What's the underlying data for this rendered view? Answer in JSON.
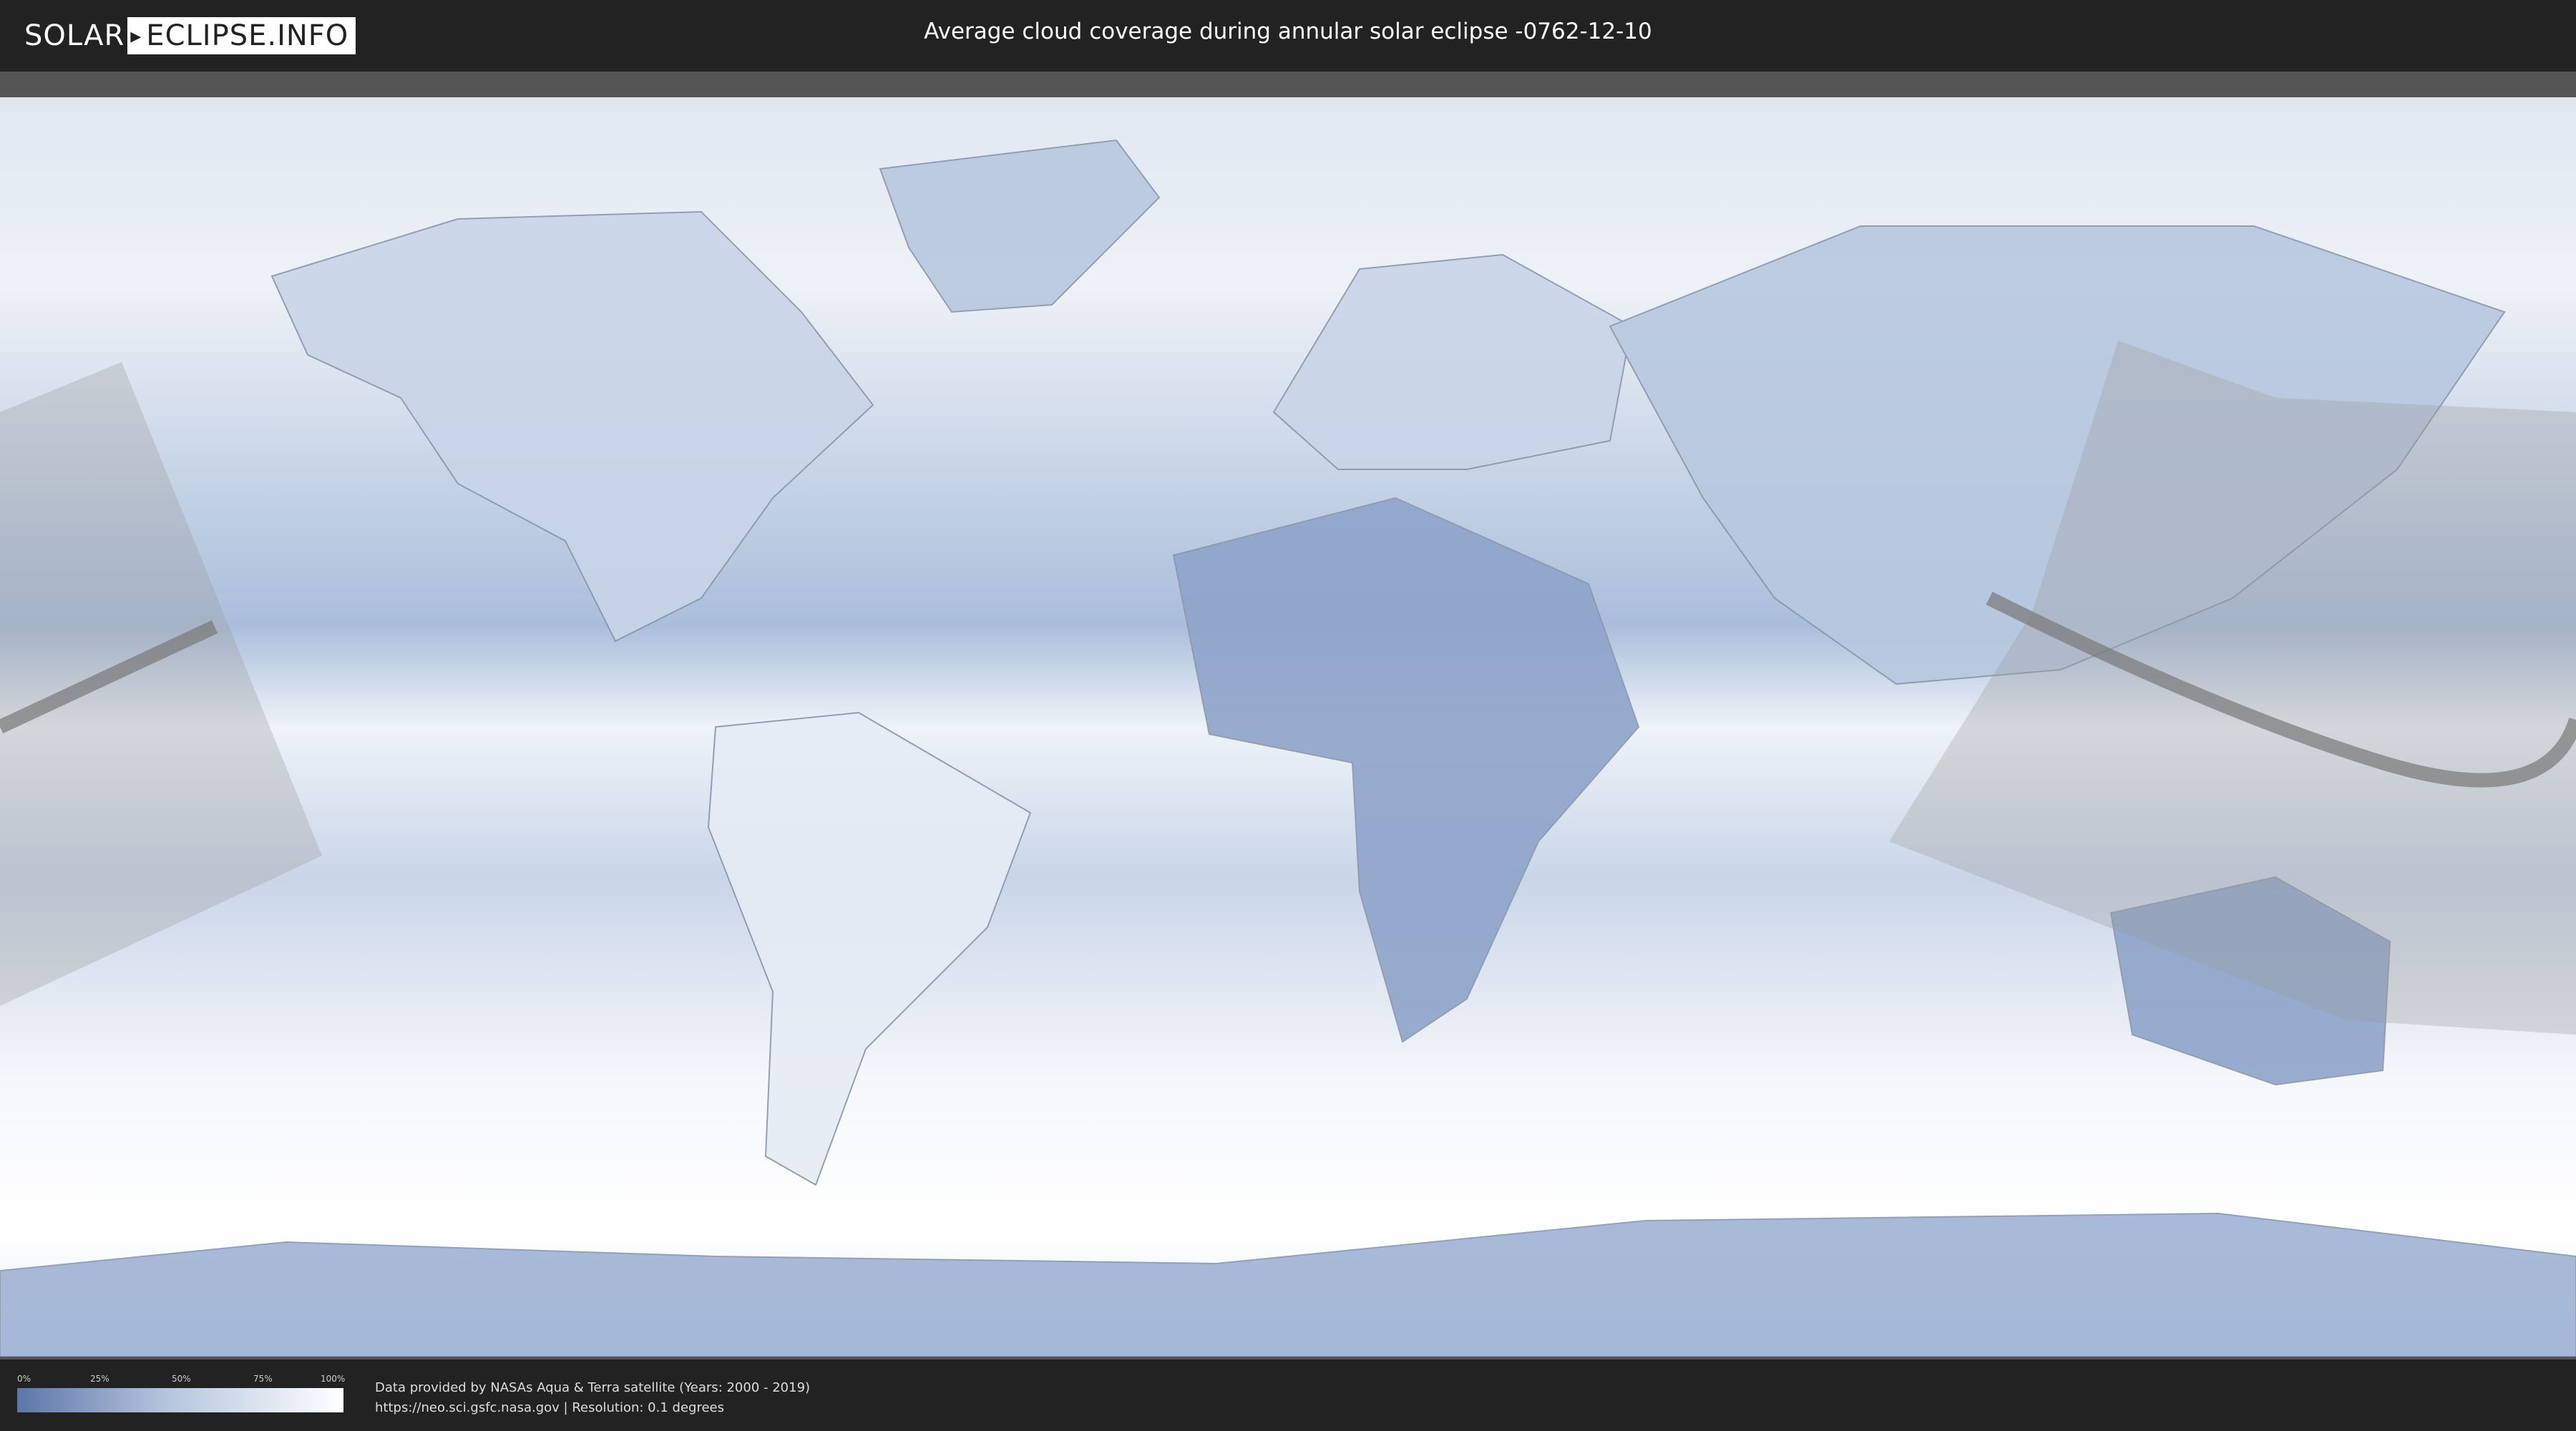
{
  "header": {
    "logo_solar": "SOLAR",
    "logo_eclipse": "ECLIPSE.INFO",
    "title": "Average cloud coverage during annular solar eclipse -0762-12-10"
  },
  "map": {
    "content": "cloud coverage world map with eclipse path overlay",
    "colors": {
      "low_coverage": "#5d76a8",
      "high_coverage": "#ffffff",
      "eclipse_shadow": "#9a9a9a"
    }
  },
  "legend": {
    "ticks": [
      "0%",
      "25%",
      "50%",
      "75%",
      "100%"
    ],
    "tick_values": [
      0,
      0.25,
      0.5,
      0.75,
      1
    ]
  },
  "footer": {
    "credit_line1": "Data provided by NASAs Aqua & Terra satellite (Years: 2000 - 2019)",
    "credit_line2": "https://neo.sci.gsfc.nasa.gov | Resolution: 0.1 degrees"
  }
}
